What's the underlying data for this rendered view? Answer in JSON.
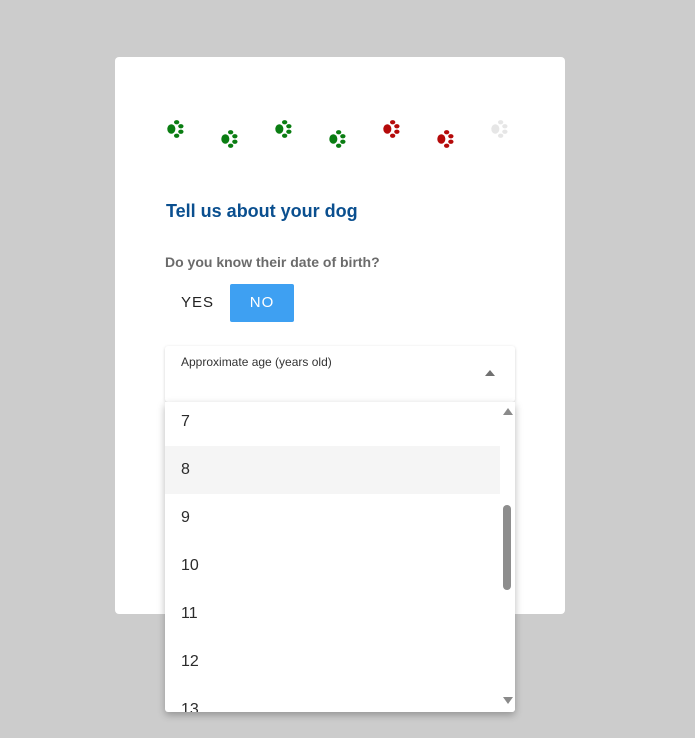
{
  "progress": {
    "paws": [
      {
        "state": "done",
        "color": "#0a7d12",
        "icon": "paw-icon"
      },
      {
        "state": "done",
        "color": "#0a7d12",
        "icon": "paw-icon"
      },
      {
        "state": "done",
        "color": "#0a7d12",
        "icon": "paw-icon"
      },
      {
        "state": "done",
        "color": "#0a7d12",
        "icon": "paw-icon"
      },
      {
        "state": "current",
        "color": "#b50a0a",
        "icon": "paw-icon"
      },
      {
        "state": "current",
        "color": "#b50a0a",
        "icon": "paw-icon"
      },
      {
        "state": "pending",
        "color": "#e6e6e6",
        "icon": "paw-icon"
      }
    ]
  },
  "form": {
    "title": "Tell us about your dog",
    "question": "Do you know their date of birth?",
    "toggle": {
      "yes_label": "YES",
      "no_label": "NO",
      "selected": "NO",
      "accent": "#3ea0f2"
    },
    "age_select": {
      "label": "Approximate age (years old)",
      "icon": "chevron-up-icon",
      "options": [
        "7",
        "8",
        "9",
        "10",
        "11",
        "12",
        "13"
      ],
      "hovered": "8"
    }
  }
}
